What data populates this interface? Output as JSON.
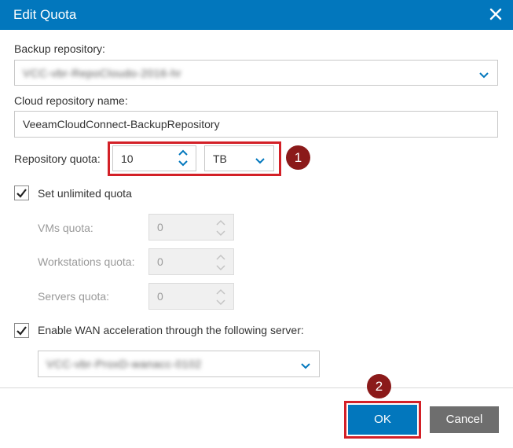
{
  "dialog": {
    "title": "Edit Quota",
    "close_icon": "close-icon"
  },
  "backup_repository": {
    "label": "Backup repository:",
    "value": "VCC-vbr-RepoCloudo-2016-hr",
    "value_obscured": true
  },
  "cloud_repository": {
    "label": "Cloud repository name:",
    "value": "VeeamCloudConnect-BackupRepository"
  },
  "repository_quota": {
    "label": "Repository quota:",
    "value": "10",
    "unit": "TB"
  },
  "unlimited_quota": {
    "label": "Set unlimited quota",
    "checked": true
  },
  "vms_quota": {
    "label": "VMs quota:",
    "value": "0",
    "disabled": true
  },
  "workstations_quota": {
    "label": "Workstations quota:",
    "value": "0",
    "disabled": true
  },
  "servers_quota": {
    "label": "Servers quota:",
    "value": "0",
    "disabled": true
  },
  "wan_acceleration": {
    "label": "Enable WAN acceleration through the following server:",
    "checked": true,
    "server_value": "VCC-vbr-ProxD-wanacc-0102",
    "value_obscured": true
  },
  "annotations": {
    "marker_1": "1",
    "marker_2": "2",
    "highlight_color": "#d32027",
    "marker_color": "#8b1a1a"
  },
  "buttons": {
    "ok": "OK",
    "cancel": "Cancel"
  },
  "colors": {
    "accent": "#0277bd",
    "cancel_bg": "#6e6e6e"
  }
}
